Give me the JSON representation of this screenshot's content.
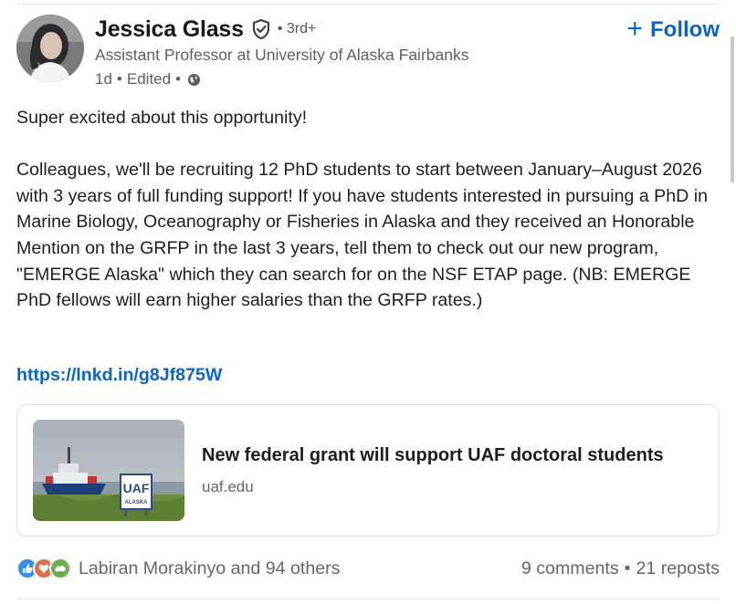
{
  "author": {
    "name": "Jessica Glass",
    "degree": "3rd+",
    "headline": "Assistant Professor at University of Alaska Fairbanks",
    "time": "1d",
    "edited": "Edited",
    "visibility_icon": "globe-icon",
    "verified_icon": "verified-shield-icon"
  },
  "follow": {
    "label": "Follow",
    "icon": "plus-icon"
  },
  "post": {
    "intro": "Super excited about this opportunity!",
    "body": "Colleagues, we'll be recruiting 12 PhD students to start between January–August 2026 with 3 years of full funding support! If you have students interested in pursuing a PhD in Marine Biology, Oceanography or Fisheries in Alaska and they received an Honorable Mention on the GRFP in the last 3 years, tell them to check out our new program, \"EMERGE Alaska\" which they can search for on the NSF ETAP page. (NB: EMERGE PhD fellows will earn higher salaries than the GRFP rates.)",
    "link": "https://lnkd.in/g8Jf875W"
  },
  "card": {
    "title": "New federal grant will support UAF doctoral students",
    "domain": "uaf.edu",
    "thumb_sign_top": "UAF",
    "thumb_sign_bottom": "ALASKA"
  },
  "social": {
    "reactions_icons": [
      "like-icon",
      "love-icon",
      "support-icon"
    ],
    "reactions_text": "Labiran Morakinyo and 94 others",
    "comments": "9 comments",
    "reposts": "21 reposts"
  },
  "colors": {
    "brand": "#0a66c2",
    "like": "#378fe9",
    "love": "#df704d",
    "support": "#6dae4f"
  }
}
